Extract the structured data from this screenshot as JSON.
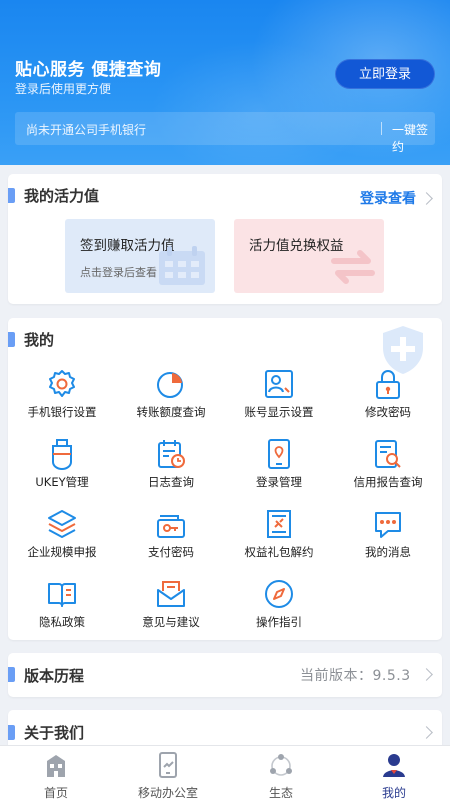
{
  "header": {
    "slogan": "贴心服务 便捷查询",
    "subtitle": "登录后使用更方便",
    "login_button": "立即登录",
    "bank_notice": "尚未开通公司手机银行",
    "sign_link": "一键签约"
  },
  "vitality": {
    "title": "我的活力值",
    "more_link": "登录查看",
    "tiles": [
      {
        "title": "签到赚取活力值",
        "subtitle": "点击登录后查看"
      },
      {
        "title": "活力值兑换权益"
      }
    ]
  },
  "mine": {
    "title": "我的",
    "items": [
      {
        "label": "手机银行设置",
        "icon": "gear-icon"
      },
      {
        "label": "转账额度查询",
        "icon": "pie-chart-icon"
      },
      {
        "label": "账号显示设置",
        "icon": "account-card-icon"
      },
      {
        "label": "修改密码",
        "icon": "lock-icon"
      },
      {
        "label": "UKEY管理",
        "icon": "ukey-icon"
      },
      {
        "label": "日志查询",
        "icon": "log-calendar-icon"
      },
      {
        "label": "登录管理",
        "icon": "phone-location-icon"
      },
      {
        "label": "信用报告查询",
        "icon": "report-search-icon"
      },
      {
        "label": "企业规模申报",
        "icon": "layers-icon"
      },
      {
        "label": "支付密码",
        "icon": "key-wallet-icon"
      },
      {
        "label": "权益礼包解约",
        "icon": "unlink-doc-icon"
      },
      {
        "label": "我的消息",
        "icon": "chat-bubble-icon"
      },
      {
        "label": "隐私政策",
        "icon": "book-icon"
      },
      {
        "label": "意见与建议",
        "icon": "envelope-icon"
      },
      {
        "label": "操作指引",
        "icon": "compass-icon"
      }
    ]
  },
  "version": {
    "title": "版本历程",
    "current": "当前版本：9.5.3"
  },
  "about": {
    "title": "关于我们"
  },
  "nav": [
    {
      "label": "首页",
      "icon": "home-building-icon"
    },
    {
      "label": "移动办公室",
      "icon": "mobile-office-icon"
    },
    {
      "label": "生态",
      "icon": "ecosystem-icon"
    },
    {
      "label": "我的",
      "icon": "user-icon",
      "active": true
    }
  ],
  "colors": {
    "primary_blue": "#1f7ae8",
    "icon_blue": "#1e8be6",
    "icon_red": "#ef6a3c",
    "active_nav": "#2a3b8f"
  }
}
